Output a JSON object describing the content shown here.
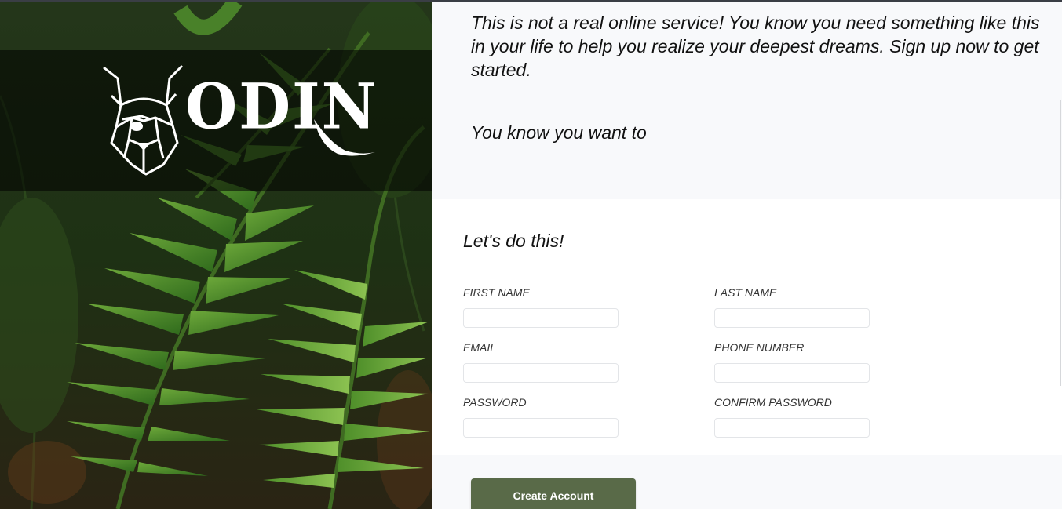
{
  "brand": {
    "name": "ODIN"
  },
  "intro": {
    "text": "This is not a real online service! You know you need something like this in your life to help you realize your deepest dreams. Sign up now to get started.",
    "sub": "You know you want to"
  },
  "form": {
    "title": "Let's do this!",
    "fields": [
      {
        "label": "FIRST NAME",
        "value": "",
        "placeholder": ""
      },
      {
        "label": "LAST NAME",
        "value": "",
        "placeholder": ""
      },
      {
        "label": "EMAIL",
        "value": "",
        "placeholder": ""
      },
      {
        "label": "PHONE NUMBER",
        "value": "",
        "placeholder": ""
      },
      {
        "label": "PASSWORD",
        "value": "",
        "placeholder": ""
      },
      {
        "label": "CONFIRM PASSWORD",
        "value": "",
        "placeholder": ""
      }
    ],
    "submit_label": "Create Account"
  },
  "colors": {
    "button": "#596a48",
    "content_bg": "#f8f9fb",
    "card_bg": "#ffffff"
  },
  "icons": {
    "logo": "viking-dog-head-icon",
    "background": "fern-leaves-image"
  }
}
